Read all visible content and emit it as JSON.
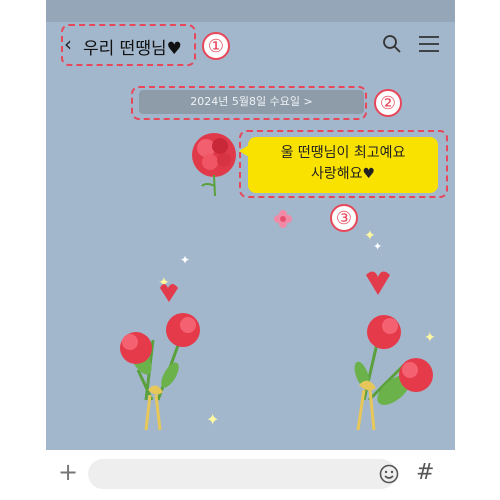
{
  "header": {
    "back_icon": "chevron-left-icon",
    "title": "우리 떤땡님",
    "title_heart": "♥",
    "search_icon": "search-icon",
    "menu_icon": "hamburger-menu-icon"
  },
  "date_divider": {
    "label": "2024년 5월8일 수요일 >"
  },
  "message": {
    "line1": "울 떤땡님이 최고예요",
    "line2": "사랑해요",
    "heart": "♥"
  },
  "annotations": {
    "one": "①",
    "two": "②",
    "three": "③"
  },
  "input_bar": {
    "plus_icon": "plus-icon",
    "value": "",
    "emoji_icon": "smiley-icon",
    "hash_label": "#"
  },
  "colors": {
    "chat_background": "#a3b7cc",
    "bubble": "#f9e200",
    "date_pill": "#8e9ca9",
    "annotation": "#e8475a"
  }
}
